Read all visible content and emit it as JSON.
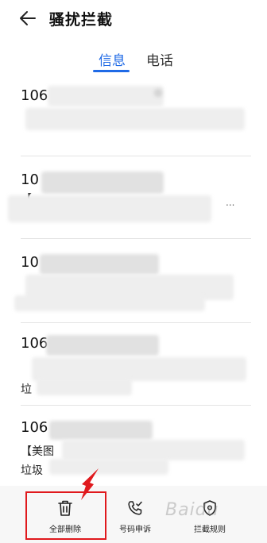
{
  "header": {
    "title": "骚扰拦截",
    "back_icon": "arrow-left-icon"
  },
  "tabs": [
    {
      "label": "信息",
      "active": true
    },
    {
      "label": "电话",
      "active": false
    }
  ],
  "messages": [
    {
      "sender": "106",
      "line1": "",
      "line2": "",
      "time": ""
    },
    {
      "sender": "10",
      "line1": "【",
      "line2": "",
      "time": "..."
    },
    {
      "sender": "10",
      "line1": "",
      "line2": "",
      "time": ""
    },
    {
      "sender": "106",
      "line1": "",
      "line2": "垃",
      "time": ""
    },
    {
      "sender": "106",
      "line1": "【美图",
      "line2": "垃圾",
      "time": ""
    }
  ],
  "bottom_bar": {
    "delete_all": "全部删除",
    "report_number": "号码申诉",
    "block_rules": "拦截规则"
  },
  "watermark": "Baidu"
}
